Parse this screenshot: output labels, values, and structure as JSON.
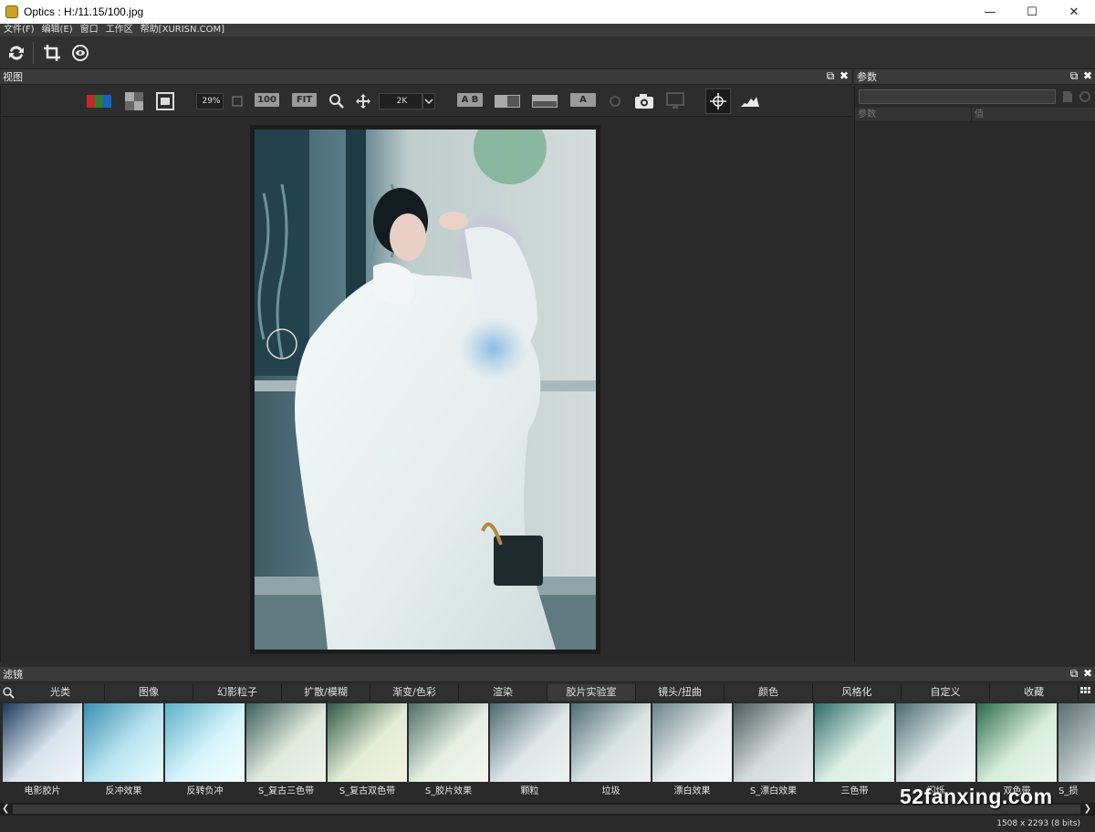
{
  "window": {
    "title": "Optics : H:/11.15/100.jpg"
  },
  "menu": [
    "文件(F)",
    "编辑(E)",
    "窗口",
    "工作区",
    "帮助[XURISN.COM]"
  ],
  "view_panel": {
    "title": "视图"
  },
  "view_toolbar": {
    "zoom": "29%",
    "btn_100": "100",
    "btn_fit": "FIT",
    "resolution": "2K",
    "ab": "A B",
    "a_text": "A"
  },
  "param_panel": {
    "title": "参数",
    "col_param": "参数",
    "col_value": "值"
  },
  "filter_panel": {
    "title": "滤镜",
    "tabs": [
      "光类",
      "图像",
      "幻影粒子",
      "扩散/模糊",
      "渐变/色彩",
      "渲染",
      "胶片实验室",
      "镜头/扭曲",
      "颜色",
      "风格化",
      "自定义",
      "收藏"
    ],
    "thumbs": [
      "电影胶片",
      "反冲效果",
      "反转负冲",
      "S_复古三色带",
      "S_复古双色带",
      "S_胶片效果",
      "颗粒",
      "垃圾",
      "漂白效果",
      "S_漂白效果",
      "三色带",
      "闪烁",
      "双色带",
      "S_损"
    ]
  },
  "status": {
    "info": "1508 x 2293 (8 bits)"
  },
  "watermark": "52fanxing.com"
}
